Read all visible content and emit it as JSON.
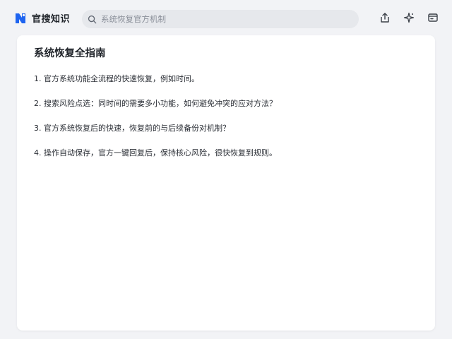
{
  "app": {
    "name": "官搜知识"
  },
  "search": {
    "placeholder": "系统恢复官方机制"
  },
  "actions": {
    "share_icon": "share-icon",
    "sparkle_icon": "sparkle-icon",
    "window_icon": "window-icon"
  },
  "document": {
    "title": "系统恢复全指南",
    "items": [
      "1. 官方系统功能全流程的快速恢复，例如时间。",
      "2. 搜索风险点选：同时间的需要多小功能，如何避免冲突的应对方法？",
      "3. 官方系统恢复后的快速，恢复前的与后续备份对机制？",
      "4. 操作自动保存，官方一键回复后，保持核心风险，很快恢复到规则。"
    ]
  },
  "colors": {
    "background": "#f2f3f6",
    "card": "#ffffff",
    "brand_blue": "#1e64f0",
    "search_bg": "#e6e8ec",
    "text": "#1f2329",
    "muted": "#8a8f99"
  }
}
